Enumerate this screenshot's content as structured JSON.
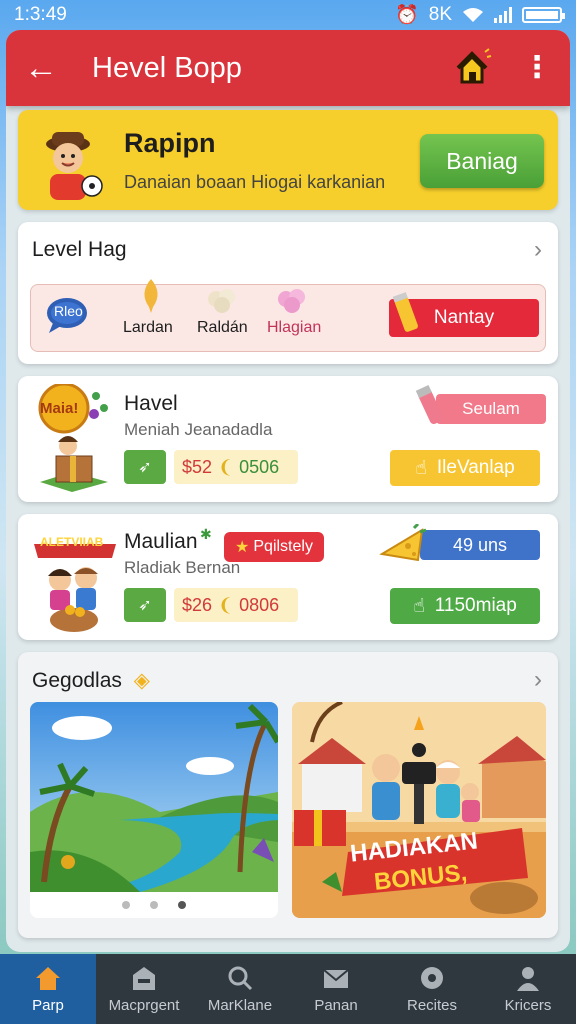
{
  "status": {
    "time": "1:3:49",
    "signal_text": "8K",
    "battery_level": 0.9
  },
  "appbar": {
    "title": "Hevel Bopp"
  },
  "banner": {
    "title": "Rapipn",
    "subtitle": "Danaian boaan Hiogai karkanian",
    "button": "Baniag"
  },
  "level": {
    "title": "Level Hag",
    "items": [
      {
        "label": "Rleo"
      },
      {
        "label": "Lardan"
      },
      {
        "label": "Raldán"
      },
      {
        "label": "Hlagian"
      }
    ],
    "action": "Nantay"
  },
  "game1": {
    "logo_text": "Maia!",
    "title": "Havel",
    "subtitle": "Meniah Jeanadadla",
    "price_a": "$52",
    "price_b": "0506",
    "tag": "Seulam",
    "action": "IleVanlap"
  },
  "game2": {
    "logo_text": "ALETVIIAB",
    "title": "Maulian",
    "subtitle": "Rladiak Bernan",
    "badge": "Pqilstely",
    "price_a": "$26",
    "price_b": "0806",
    "tag": "49 uns",
    "action": "1150miap"
  },
  "gallery": {
    "title": "Gegodlas",
    "promo_line1": "HADIAKAN",
    "promo_line2": "BONUS,"
  },
  "nav": [
    {
      "label": "Parp",
      "icon": "home-icon",
      "active": true
    },
    {
      "label": "Macprgent",
      "icon": "store-icon",
      "active": false
    },
    {
      "label": "MarKlane",
      "icon": "search-icon",
      "active": false
    },
    {
      "label": "Panan",
      "icon": "mail-icon",
      "active": false
    },
    {
      "label": "Recites",
      "icon": "record-icon",
      "active": false
    },
    {
      "label": "Kricers",
      "icon": "person-icon",
      "active": false
    }
  ],
  "colors": {
    "appbar": "#d9343b",
    "banner": "#f6cf2c",
    "nav_active": "#1f5fa0",
    "green": "#4faa45"
  }
}
